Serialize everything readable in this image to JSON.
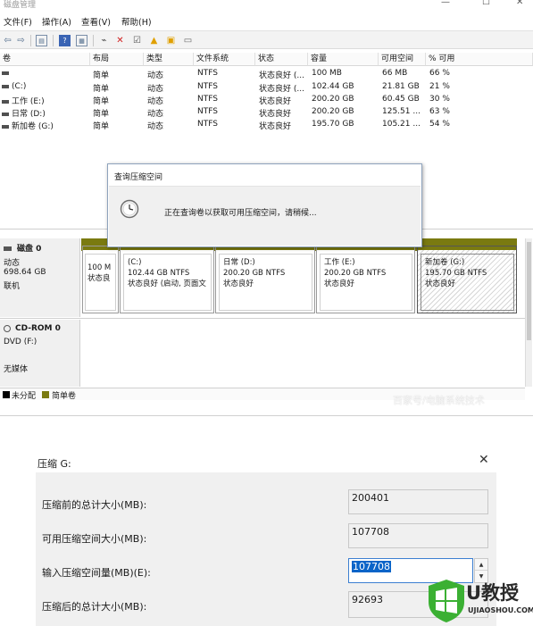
{
  "window": {
    "title": "磁盘管理"
  },
  "menu": [
    "文件(F)",
    "操作(A)",
    "查看(V)",
    "帮助(H)"
  ],
  "columns": [
    "卷",
    "布局",
    "类型",
    "文件系统",
    "状态",
    "容量",
    "可用空间",
    "% 可用"
  ],
  "volumes": [
    {
      "name": "",
      "layout": "简单",
      "type": "动态",
      "fs": "NTFS",
      "status": "状态良好 (...",
      "capacity": "100 MB",
      "free": "66 MB",
      "pct": "66 %"
    },
    {
      "name": "(C:)",
      "layout": "简单",
      "type": "动态",
      "fs": "NTFS",
      "status": "状态良好 (...",
      "capacity": "102.44 GB",
      "free": "21.81 GB",
      "pct": "21 %"
    },
    {
      "name": "工作 (E:)",
      "layout": "简单",
      "type": "动态",
      "fs": "NTFS",
      "status": "状态良好",
      "capacity": "200.20 GB",
      "free": "60.45 GB",
      "pct": "30 %"
    },
    {
      "name": "日常 (D:)",
      "layout": "简单",
      "type": "动态",
      "fs": "NTFS",
      "status": "状态良好",
      "capacity": "200.20 GB",
      "free": "125.51 ...",
      "pct": "63 %"
    },
    {
      "name": "新加卷 (G:)",
      "layout": "简单",
      "type": "动态",
      "fs": "NTFS",
      "status": "状态良好",
      "capacity": "195.70 GB",
      "free": "105.21 ...",
      "pct": "54 %"
    }
  ],
  "query_dialog": {
    "title": "查询压缩空间",
    "message": "正在查询卷以获取可用压缩空间，请稍候..."
  },
  "disk0": {
    "name": "磁盘 0",
    "type": "动态",
    "size": "698.64 GB",
    "state": "联机",
    "partitions": [
      {
        "name": "",
        "line1": "100 M",
        "line2": "状态良"
      },
      {
        "name": "(C:)",
        "line1": "102.44 GB NTFS",
        "line2": "状态良好 (启动, 页面文"
      },
      {
        "name": "日常  (D:)",
        "line1": "200.20 GB NTFS",
        "line2": "状态良好"
      },
      {
        "name": "工作  (E:)",
        "line1": "200.20 GB NTFS",
        "line2": "状态良好"
      },
      {
        "name": "新加卷  (G:)",
        "line1": "195.70 GB NTFS",
        "line2": "状态良好"
      }
    ]
  },
  "cdrom0": {
    "name": "CD-ROM 0",
    "drive": "DVD (F:)",
    "media": "无媒体"
  },
  "legend": {
    "unallocated": "未分配",
    "simple": "简单卷"
  },
  "watermark": "百家号/电脑系统技术",
  "shrink_dialog": {
    "title": "压缩 G:",
    "fields": [
      {
        "label": "压缩前的总计大小(MB):",
        "value": "200401"
      },
      {
        "label": "可用压缩空间大小(MB):",
        "value": "107708"
      },
      {
        "label": "输入压缩空间量(MB)(E):",
        "value": "107708"
      },
      {
        "label": "压缩后的总计大小(MB):",
        "value": "92693"
      }
    ]
  },
  "logo": {
    "big": "U教授",
    "small": "UJIAOSHOU.COM"
  },
  "colors": {
    "primary_partition_bar": "#1f3c8a",
    "simple_volume_bar": "#7a7a10",
    "selection": "#0a64c8",
    "logo_green": "#3bb033"
  }
}
